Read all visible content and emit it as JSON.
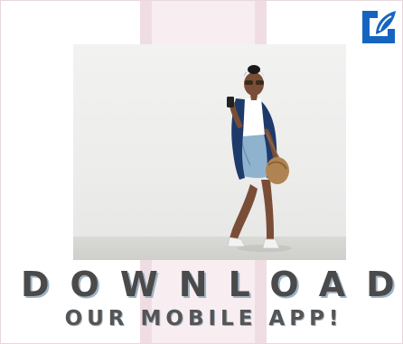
{
  "banner": {
    "headline": "DOWNLOAD",
    "subheadline": "OUR MOBILE APP!",
    "logo_icon": "brand-logo-icon",
    "photo_icon": "woman-with-phone-photo",
    "colors": {
      "logo": "#1565c0",
      "headline": "#4a4a4a",
      "headline_shadow": "#a0b4c4",
      "stripe": "#f0dde4",
      "background": "#ffffff"
    }
  }
}
